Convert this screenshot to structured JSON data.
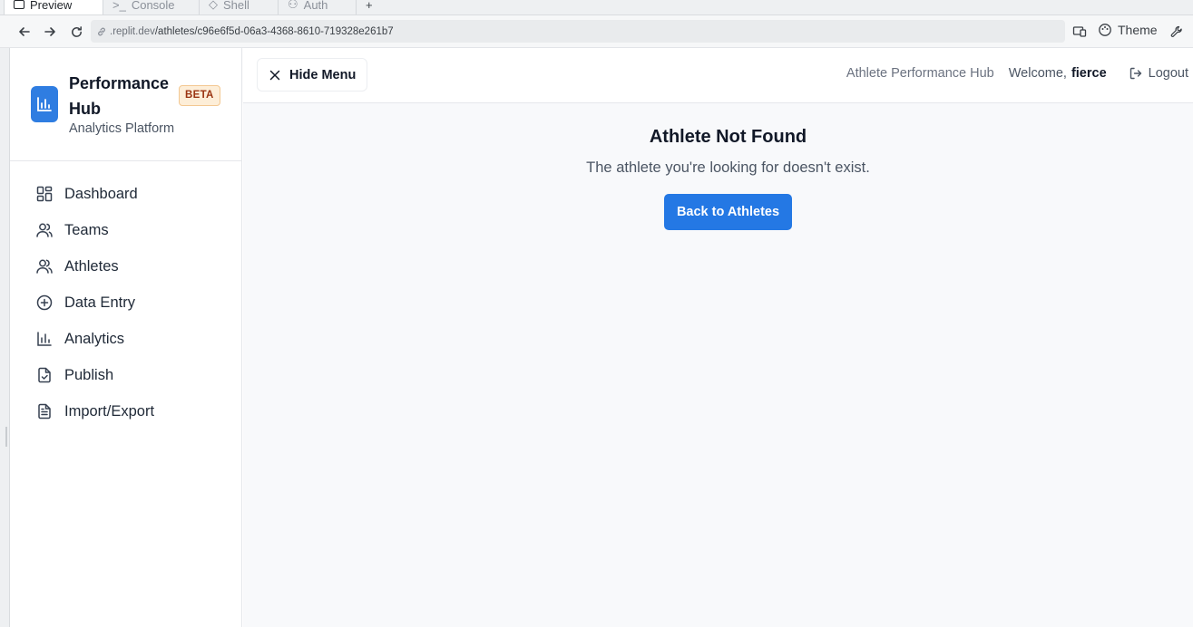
{
  "browser": {
    "tabs": [
      {
        "label": "Preview",
        "active": true
      },
      {
        "label": "Console",
        "active": false
      },
      {
        "label": "Shell",
        "active": false
      },
      {
        "label": "Auth",
        "active": false
      }
    ],
    "new_tab": "+",
    "url_domain": ".replit.dev",
    "url_path": "/athletes/c96e6f5d-06a3-4368-8610-719328e261b7",
    "theme_label": "Theme"
  },
  "brand": {
    "title": "Performance Hub",
    "badge": "BETA",
    "subtitle": "Analytics Platform",
    "accent": "#2f7de1"
  },
  "sidebar": {
    "items": [
      {
        "label": "Dashboard",
        "icon": "dashboard-icon"
      },
      {
        "label": "Teams",
        "icon": "users-icon"
      },
      {
        "label": "Athletes",
        "icon": "user-group-icon"
      },
      {
        "label": "Data Entry",
        "icon": "plus-circle-icon"
      },
      {
        "label": "Analytics",
        "icon": "bar-chart-icon"
      },
      {
        "label": "Publish",
        "icon": "file-check-icon"
      },
      {
        "label": "Import/Export",
        "icon": "file-text-icon"
      }
    ]
  },
  "header": {
    "hide_menu": "Hide Menu",
    "app_name": "Athlete Performance Hub",
    "welcome": "Welcome,",
    "username": "fierce",
    "logout": "Logout"
  },
  "main": {
    "title": "Athlete Not Found",
    "message": "The athlete you're looking for doesn't exist.",
    "back_button": "Back to Athletes",
    "button_color": "#2478e4"
  }
}
